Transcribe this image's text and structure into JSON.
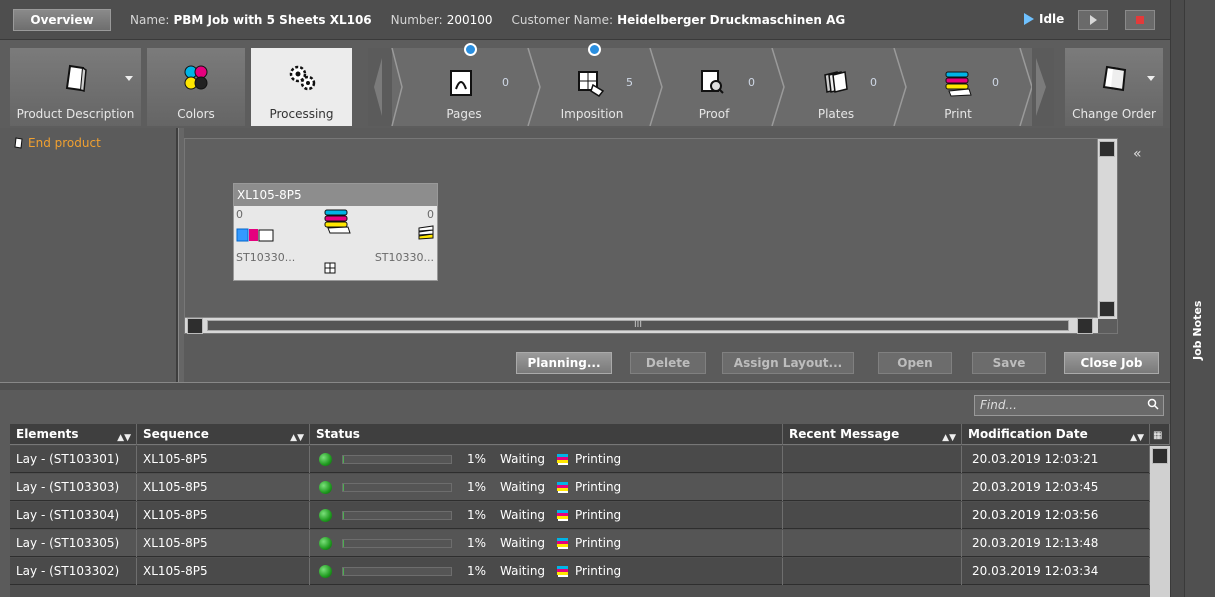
{
  "header": {
    "overview_label": "Overview",
    "name_label": "Name:",
    "name_value": "PBM Job with 5 Sheets XL106",
    "number_label": "Number:",
    "number_value": "200100",
    "customer_label": "Customer Name:",
    "customer_value": "Heidelberger Druckmaschinen AG",
    "status": "Idle"
  },
  "toolbar": {
    "product_description": "Product Description",
    "colors": "Colors",
    "processing": "Processing",
    "change_order": "Change Order"
  },
  "pipeline": [
    {
      "label": "Pages",
      "count": "0"
    },
    {
      "label": "Imposition",
      "count": "5"
    },
    {
      "label": "Proof",
      "count": "0"
    },
    {
      "label": "Plates",
      "count": "0"
    },
    {
      "label": "Print",
      "count": "0"
    }
  ],
  "left_panel": {
    "end_product": "End product"
  },
  "node": {
    "title": "XL105-8P5",
    "left_count": "0",
    "right_count": "0",
    "left_id": "ST10330...",
    "right_id": "ST10330..."
  },
  "scroll_thumb": "III",
  "actions": {
    "planning": "Planning...",
    "delete": "Delete",
    "assign_layout": "Assign Layout...",
    "open": "Open",
    "save": "Save",
    "close_job": "Close Job"
  },
  "find_placeholder": "Find...",
  "table": {
    "headers": [
      "Elements",
      "Sequence",
      "Status",
      "Recent Message",
      "Modification Date"
    ],
    "rows": [
      {
        "element": "Lay - (ST103301)",
        "sequence": "XL105-8P5",
        "percent": "1%",
        "state": "Waiting",
        "activity": "Printing",
        "progress": 0.01,
        "message": "",
        "date": "20.03.2019 12:03:21"
      },
      {
        "element": "Lay - (ST103303)",
        "sequence": "XL105-8P5",
        "percent": "1%",
        "state": "Waiting",
        "activity": "Printing",
        "progress": 0.01,
        "message": "",
        "date": "20.03.2019 12:03:45"
      },
      {
        "element": "Lay - (ST103304)",
        "sequence": "XL105-8P5",
        "percent": "1%",
        "state": "Waiting",
        "activity": "Printing",
        "progress": 0.01,
        "message": "",
        "date": "20.03.2019 12:03:56"
      },
      {
        "element": "Lay - (ST103305)",
        "sequence": "XL105-8P5",
        "percent": "1%",
        "state": "Waiting",
        "activity": "Printing",
        "progress": 0.01,
        "message": "",
        "date": "20.03.2019 12:13:48"
      },
      {
        "element": "Lay - (ST103302)",
        "sequence": "XL105-8P5",
        "percent": "1%",
        "state": "Waiting",
        "activity": "Printing",
        "progress": 0.01,
        "message": "",
        "date": "20.03.2019 12:03:34"
      }
    ]
  },
  "job_notes": "Job Notes"
}
